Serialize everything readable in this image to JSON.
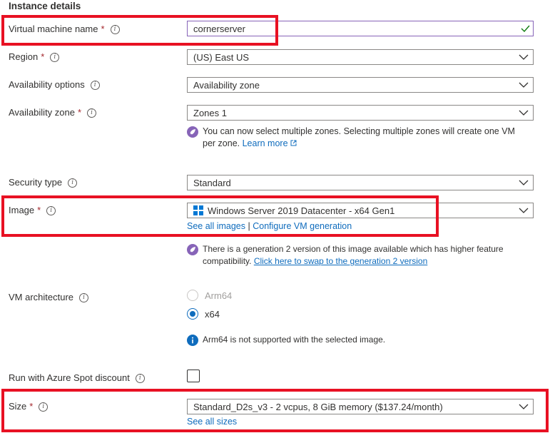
{
  "section_title": "Instance details",
  "vm_name": {
    "label": "Virtual machine name",
    "value": "cornerserver"
  },
  "region": {
    "label": "Region",
    "value": "(US) East US"
  },
  "availability_options": {
    "label": "Availability options",
    "value": "Availability zone"
  },
  "availability_zone": {
    "label": "Availability zone",
    "value": "Zones 1",
    "note": "You can now select multiple zones. Selecting multiple zones will create one VM",
    "note_line2": "per zone.",
    "learn_more": "Learn more"
  },
  "security_type": {
    "label": "Security type",
    "value": "Standard"
  },
  "image": {
    "label": "Image",
    "value": "Windows Server 2019 Datacenter - x64 Gen1",
    "see_all": "See all images",
    "separator": "|",
    "configure": "Configure VM generation",
    "note": "There is a generation 2 version of this image available which has higher feature",
    "note_line2_prefix": "compatibility.",
    "note_link": "Click here to swap to the generation 2 version"
  },
  "vm_architecture": {
    "label": "VM architecture",
    "options": [
      {
        "label": "Arm64",
        "selected": false,
        "disabled": true
      },
      {
        "label": "x64",
        "selected": true,
        "disabled": false
      }
    ],
    "info_note": "Arm64 is not supported with the selected image."
  },
  "spot": {
    "label": "Run with Azure Spot discount",
    "checked": false
  },
  "size": {
    "label": "Size",
    "value": "Standard_D2s_v3 - 2 vcpus, 8 GiB memory ($137.24/month)",
    "see_all": "See all sizes"
  },
  "required_mark": "*",
  "colors": {
    "accent": "#0f6cbd",
    "highlight": "#e81123",
    "rocket": "#8764b8",
    "valid": "#107c10"
  }
}
